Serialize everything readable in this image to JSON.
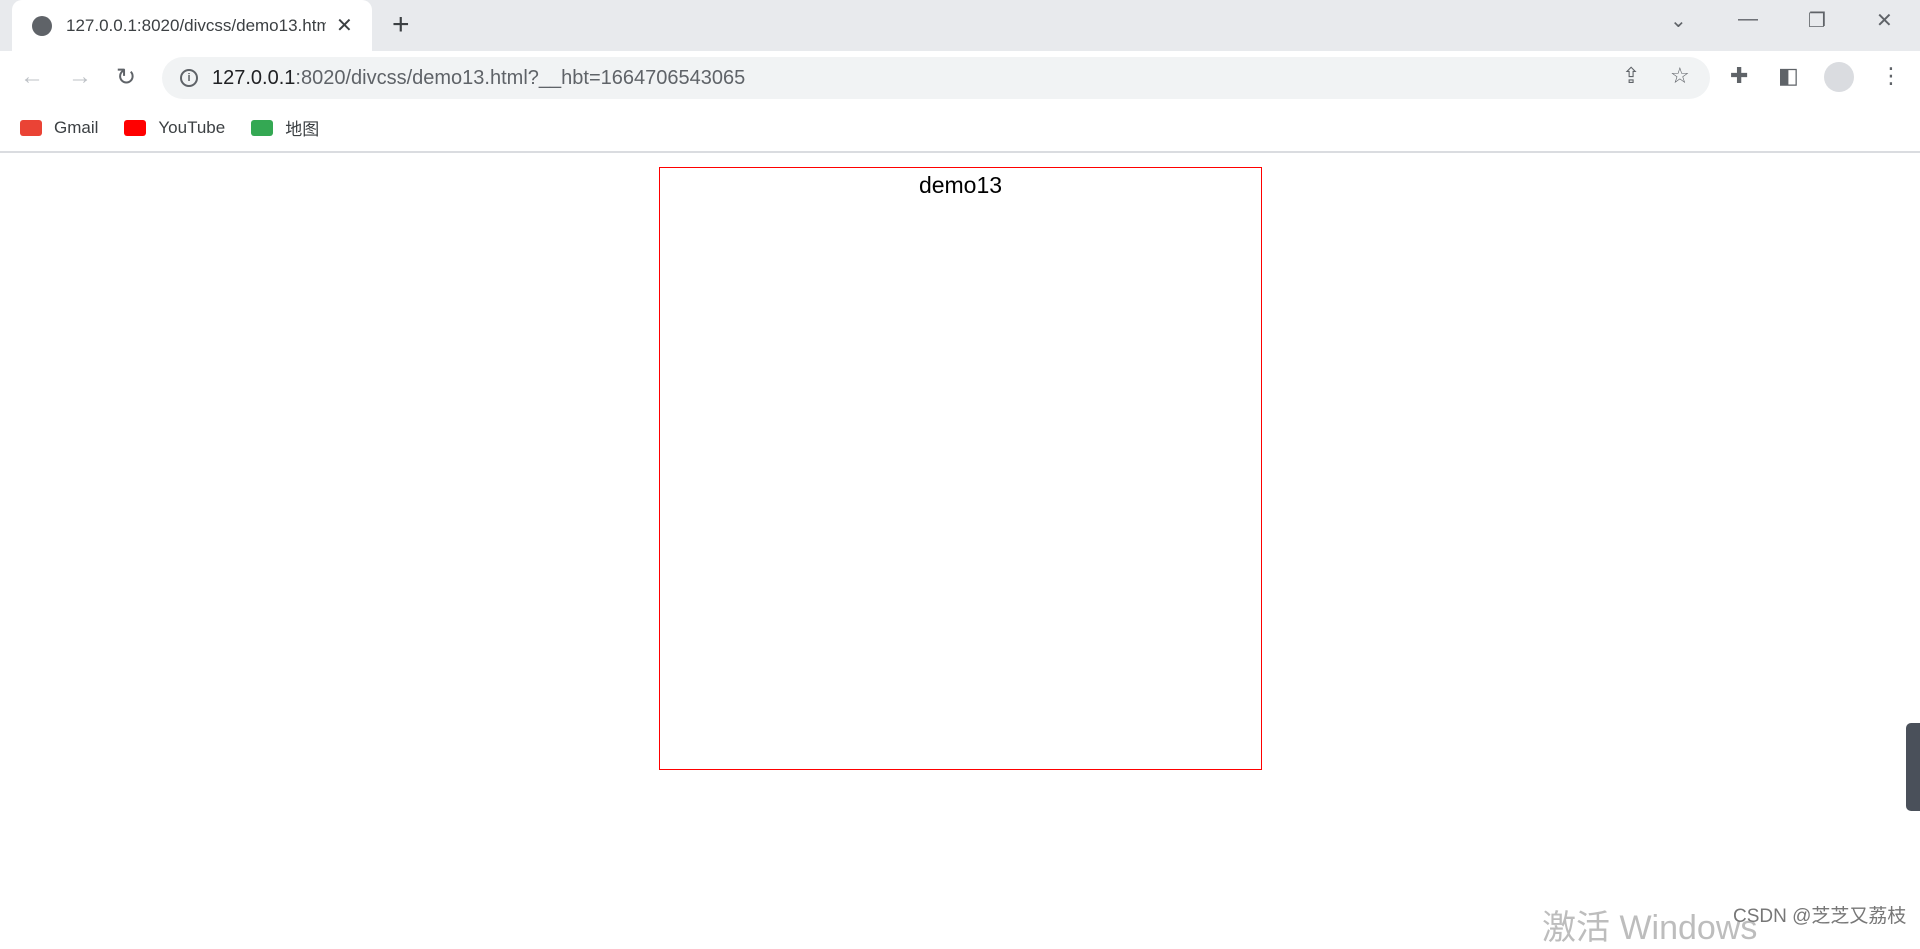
{
  "browser": {
    "tab": {
      "title": "127.0.0.1:8020/divcss/demo13.html?__hbt=1664706543065",
      "close": "✕"
    },
    "new_tab": "+",
    "url": {
      "host": "127.0.0.1",
      "rest": ":8020/divcss/demo13.html?__hbt=1664706543065"
    },
    "bookmarks": [
      {
        "label": "Gmail",
        "color": "#ea4335"
      },
      {
        "label": "YouTube",
        "color": "#ff0000"
      },
      {
        "label": "地图",
        "color": "#34a853"
      }
    ]
  },
  "page": {
    "box_text": "demo13",
    "box_border_color": "#ff0000"
  },
  "overlay": {
    "watermark": "激活 Windows",
    "csdn": "CSDN @芝芝又荔枝"
  }
}
